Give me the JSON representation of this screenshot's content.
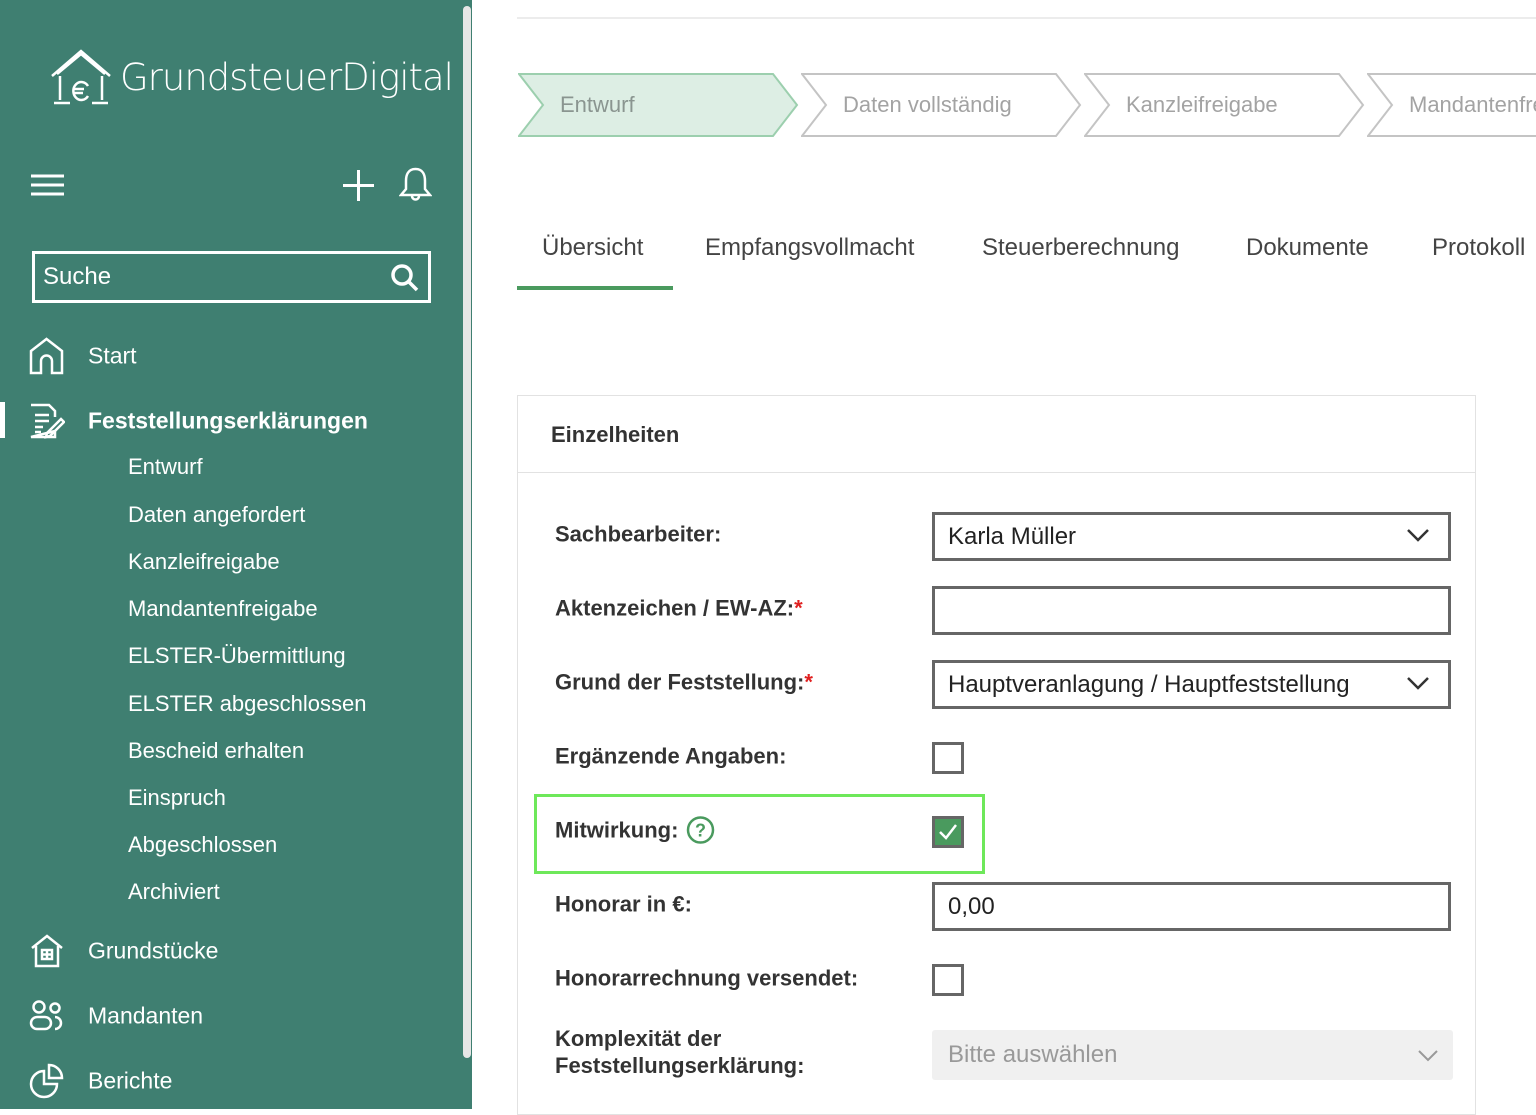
{
  "app": {
    "name": "GrundsteuerDigital"
  },
  "sidebar": {
    "search_placeholder": "Suche",
    "items": [
      {
        "label": "Start"
      },
      {
        "label": "Feststellungserklärungen"
      },
      {
        "label": "Grundstücke"
      },
      {
        "label": "Mandanten"
      },
      {
        "label": "Berichte"
      }
    ],
    "subitems": [
      "Entwurf",
      "Daten angefordert",
      "Kanzleifreigabe",
      "Mandantenfreigabe",
      "ELSTER-Übermittlung",
      "ELSTER abgeschlossen",
      "Bescheid erhalten",
      "Einspruch",
      "Abgeschlossen",
      "Archiviert"
    ]
  },
  "steps": [
    {
      "label": "Entwurf",
      "active": true
    },
    {
      "label": "Daten vollständig"
    },
    {
      "label": "Kanzleifreigabe"
    },
    {
      "label": "Mandantenfreigabe"
    }
  ],
  "tabs": [
    "Übersicht",
    "Empfangsvollmacht",
    "Steuerberechnung",
    "Dokumente",
    "Protokoll"
  ],
  "panel": {
    "title": "Einzelheiten",
    "sachbearbeiter": {
      "label": "Sachbearbeiter:",
      "value": "Karla Müller"
    },
    "aktenzeichen": {
      "label": "Aktenzeichen / EW-AZ:",
      "required": "*",
      "value": ""
    },
    "grund": {
      "label": "Grund der Feststellung:",
      "required": "*",
      "value": "Hauptveranlagung / Hauptfeststellung"
    },
    "ergaenzende": {
      "label": "Ergänzende Angaben:",
      "checked": false
    },
    "mitwirkung": {
      "label": "Mitwirkung:",
      "checked": true
    },
    "honorar": {
      "label": "Honorar in €:",
      "value": "0,00"
    },
    "honorarrechnung": {
      "label": "Honorarrechnung versendet:",
      "checked": false
    },
    "komplexitaet": {
      "label_line1": "Komplexität der",
      "label_line2": "Feststellungserklärung:",
      "placeholder": "Bitte auswählen"
    }
  },
  "colors": {
    "sidebar": "#3f7f71",
    "accent": "#4a9a5e",
    "highlight": "#6ee85a"
  }
}
